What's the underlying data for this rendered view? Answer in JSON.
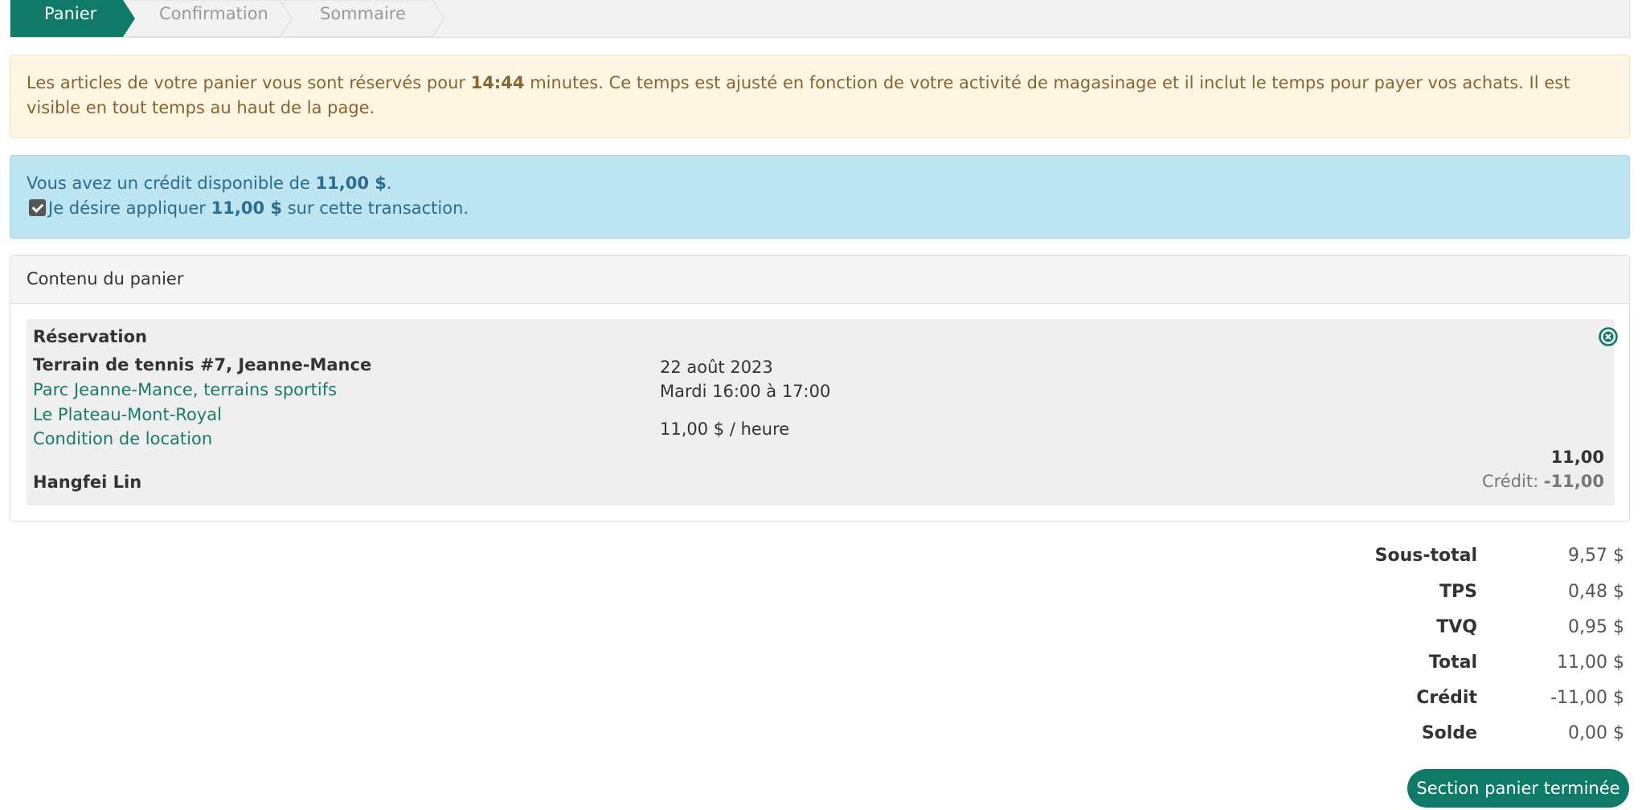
{
  "steps": [
    {
      "label": "Panier",
      "active": true
    },
    {
      "label": "Confirmation",
      "active": false
    },
    {
      "label": "Sommaire",
      "active": false
    }
  ],
  "reservation_notice": {
    "text_before": "Les articles de votre panier vous sont réservés pour ",
    "time": "14:44",
    "text_after": " minutes. Ce temps est ajusté en fonction de votre activité de magasinage et il inclut le temps pour payer vos achats. Il est visible en tout temps au haut de la page."
  },
  "credit_notice": {
    "line1_before": "Vous avez un crédit disponible de ",
    "line1_amount": "11,00 $",
    "line1_after": ".",
    "apply_checked": true,
    "line2_before": "Je désire appliquer ",
    "line2_amount": "11,00 $",
    "line2_after": " sur cette transaction."
  },
  "cart": {
    "heading": "Contenu du panier",
    "item": {
      "type": "Réservation",
      "facility": "Terrain de tennis #7, Jeanne-Mance",
      "park": "Parc Jeanne-Mance, terrains sportifs",
      "borough": "Le Plateau-Mont-Royal",
      "rental_conditions": "Condition de location",
      "customer": "Hangfei Lin",
      "date": "22 août 2023",
      "time_slot": "Mardi 16:00 à 17:00",
      "rate": "11,00 $ / heure",
      "price": "11,00",
      "credit_label": "Crédit: ",
      "credit_value": "-11,00",
      "remove_icon": "remove-circle-icon"
    }
  },
  "totals": [
    {
      "label": "Sous-total",
      "value": "9,57 $"
    },
    {
      "label": "TPS",
      "value": "0,48 $"
    },
    {
      "label": "TVQ",
      "value": "0,95 $"
    },
    {
      "label": "Total",
      "value": "11,00 $"
    },
    {
      "label": "Crédit",
      "value": "-11,00 $"
    },
    {
      "label": "Solde",
      "value": "0,00 $"
    }
  ],
  "actions": {
    "done_label": "Section panier terminée"
  },
  "colors": {
    "primary": "#0f7a68",
    "warning_bg": "#fcf6e3",
    "info_bg": "#bde4f1"
  }
}
